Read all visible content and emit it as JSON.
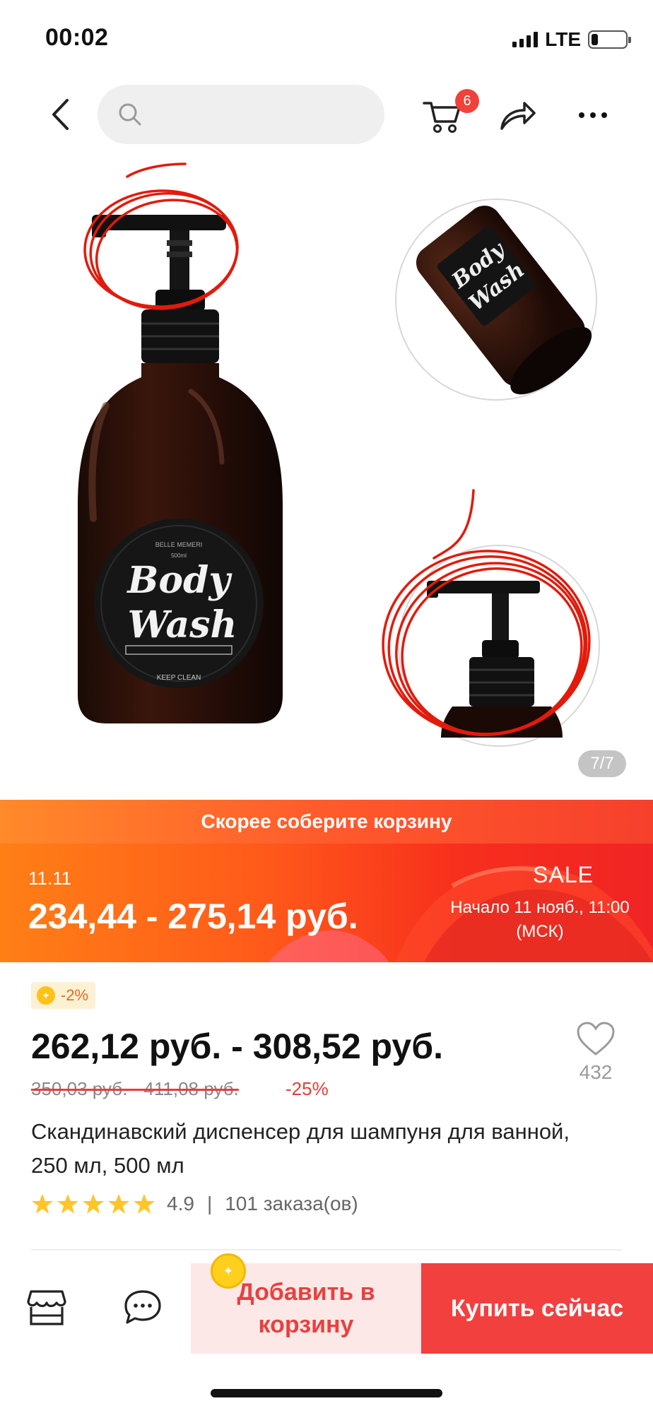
{
  "status_bar": {
    "time": "00:02",
    "network": "LTE",
    "battery_level": 0.2
  },
  "nav": {
    "search_placeholder": "",
    "cart_count": "6"
  },
  "gallery": {
    "counter": "7/7",
    "label_line1": "Body",
    "label_line2": "Wash",
    "label_tagline": "KEEP CLEAN"
  },
  "promo": {
    "strip_text": "Скорее соберите корзину",
    "date": "11.11",
    "price": "234,44 - 275,14 руб.",
    "sale": "SALE",
    "start": "Начало 11 нояб., 11:00 (МСК)"
  },
  "product": {
    "coin_discount": "-2%",
    "price": "262,12 руб. - 308,52 руб.",
    "old_price": "350,03 руб. - 411,08 руб.",
    "discount": "-25%",
    "wish_count": "432",
    "title": "Скандинавский диспенсер для шампуня для ванной, 250 мл, 500 мл",
    "rating": "4.9",
    "orders": "101 заказа(ов)",
    "stars": 5
  },
  "bottom_bar": {
    "add_to_cart": "Добавить в корзину",
    "buy_now": "Купить сейчас"
  },
  "colors": {
    "accent": "#f2403f",
    "promo_orange": "#ff7f16",
    "star": "#ffc52b"
  }
}
